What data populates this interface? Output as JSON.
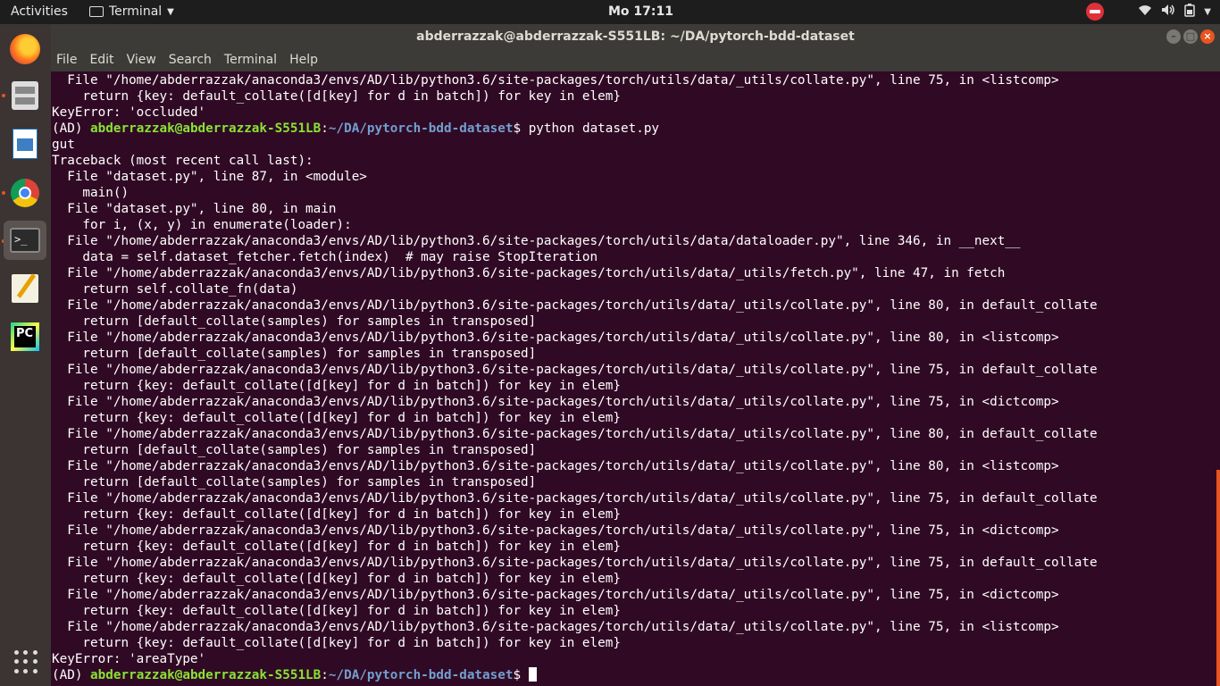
{
  "topbar": {
    "activities": "Activities",
    "app_name": "Terminal",
    "clock": "Mo 17:11"
  },
  "window": {
    "title": "abderrazzak@abderrazzak-S551LB: ~/DA/pytorch-bdd-dataset"
  },
  "menu": [
    "File",
    "Edit",
    "View",
    "Search",
    "Terminal",
    "Help"
  ],
  "dock": [
    "firefox-icon",
    "files-icon",
    "document-viewer-icon",
    "chrome-icon",
    "terminal-icon",
    "text-editor-icon",
    "pycharm-icon",
    "show-apps-icon"
  ],
  "prompt": {
    "env": "(AD) ",
    "user": "abderrazzak@abderrazzak-S551LB",
    "path": "~/DA/pytorch-bdd-dataset",
    "command": "python dataset.py"
  },
  "terminal_lines": [
    "  File \"/home/abderrazzak/anaconda3/envs/AD/lib/python3.6/site-packages/torch/utils/data/_utils/collate.py\", line 75, in <listcomp>",
    "    return {key: default_collate([d[key] for d in batch]) for key in elem}",
    "KeyError: 'occluded'",
    "__PROMPT_CMD__",
    "gut",
    "Traceback (most recent call last):",
    "  File \"dataset.py\", line 87, in <module>",
    "    main()",
    "  File \"dataset.py\", line 80, in main",
    "    for i, (x, y) in enumerate(loader):",
    "  File \"/home/abderrazzak/anaconda3/envs/AD/lib/python3.6/site-packages/torch/utils/data/dataloader.py\", line 346, in __next__",
    "    data = self.dataset_fetcher.fetch(index)  # may raise StopIteration",
    "  File \"/home/abderrazzak/anaconda3/envs/AD/lib/python3.6/site-packages/torch/utils/data/_utils/fetch.py\", line 47, in fetch",
    "    return self.collate_fn(data)",
    "  File \"/home/abderrazzak/anaconda3/envs/AD/lib/python3.6/site-packages/torch/utils/data/_utils/collate.py\", line 80, in default_collate",
    "    return [default_collate(samples) for samples in transposed]",
    "  File \"/home/abderrazzak/anaconda3/envs/AD/lib/python3.6/site-packages/torch/utils/data/_utils/collate.py\", line 80, in <listcomp>",
    "    return [default_collate(samples) for samples in transposed]",
    "  File \"/home/abderrazzak/anaconda3/envs/AD/lib/python3.6/site-packages/torch/utils/data/_utils/collate.py\", line 75, in default_collate",
    "    return {key: default_collate([d[key] for d in batch]) for key in elem}",
    "  File \"/home/abderrazzak/anaconda3/envs/AD/lib/python3.6/site-packages/torch/utils/data/_utils/collate.py\", line 75, in <dictcomp>",
    "    return {key: default_collate([d[key] for d in batch]) for key in elem}",
    "  File \"/home/abderrazzak/anaconda3/envs/AD/lib/python3.6/site-packages/torch/utils/data/_utils/collate.py\", line 80, in default_collate",
    "    return [default_collate(samples) for samples in transposed]",
    "  File \"/home/abderrazzak/anaconda3/envs/AD/lib/python3.6/site-packages/torch/utils/data/_utils/collate.py\", line 80, in <listcomp>",
    "    return [default_collate(samples) for samples in transposed]",
    "  File \"/home/abderrazzak/anaconda3/envs/AD/lib/python3.6/site-packages/torch/utils/data/_utils/collate.py\", line 75, in default_collate",
    "    return {key: default_collate([d[key] for d in batch]) for key in elem}",
    "  File \"/home/abderrazzak/anaconda3/envs/AD/lib/python3.6/site-packages/torch/utils/data/_utils/collate.py\", line 75, in <dictcomp>",
    "    return {key: default_collate([d[key] for d in batch]) for key in elem}",
    "  File \"/home/abderrazzak/anaconda3/envs/AD/lib/python3.6/site-packages/torch/utils/data/_utils/collate.py\", line 75, in default_collate",
    "    return {key: default_collate([d[key] for d in batch]) for key in elem}",
    "  File \"/home/abderrazzak/anaconda3/envs/AD/lib/python3.6/site-packages/torch/utils/data/_utils/collate.py\", line 75, in <dictcomp>",
    "    return {key: default_collate([d[key] for d in batch]) for key in elem}",
    "  File \"/home/abderrazzak/anaconda3/envs/AD/lib/python3.6/site-packages/torch/utils/data/_utils/collate.py\", line 75, in <listcomp>",
    "    return {key: default_collate([d[key] for d in batch]) for key in elem}",
    "KeyError: 'areaType'",
    "__PROMPT_EMPTY__"
  ],
  "colors": {
    "terminal_bg": "#300a24",
    "prompt_user": "#8ae234",
    "prompt_path": "#729fcf",
    "accent": "#e95420"
  }
}
